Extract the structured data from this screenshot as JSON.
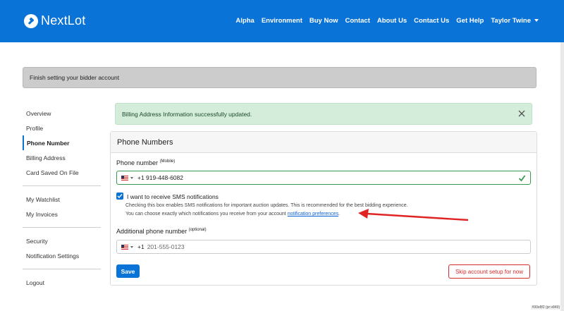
{
  "navbar": {
    "brand": "NextLot",
    "links": [
      "Alpha",
      "Environment",
      "Buy Now",
      "Contact",
      "About Us",
      "Contact Us",
      "Get Help"
    ],
    "user": "Taylor Twine",
    "color": "#0a73d8"
  },
  "banner": {
    "text": "Finish setting your bidder account"
  },
  "sidebar": {
    "group1": [
      "Overview",
      "Profile",
      "Phone Number",
      "Billing Address",
      "Card Saved On File"
    ],
    "group2": [
      "My Watchlist",
      "My Invoices"
    ],
    "group3": [
      "Security",
      "Notification Settings"
    ],
    "group4": [
      "Logout"
    ],
    "active": "Phone Number"
  },
  "alert": {
    "text": "Billing Address Information successfully updated.",
    "icon": "close-icon"
  },
  "card": {
    "title": "Phone Numbers",
    "phone_label": "Phone number",
    "phone_label_sup": "(Mobile)",
    "phone_value": "+1 919-448-6082",
    "sms_label": "I want to receive SMS notifications",
    "sms_checked": true,
    "help_line1": "Checking this box enables SMS notifications for important auction updates. This is recommended for the best bidding experience.",
    "help_line2": "You can choose exactly which notifications you receive from your account",
    "help_link": "notification preferences",
    "help_end": ".",
    "additional_label": "Additional phone number",
    "additional_label_sup": "(optional)",
    "additional_prefix": "+1",
    "additional_placeholder": "201-555-0123",
    "save_label": "Save",
    "skip_label": "Skip account setup for now"
  },
  "watermark": "#90e8f2 (pr:v849)"
}
